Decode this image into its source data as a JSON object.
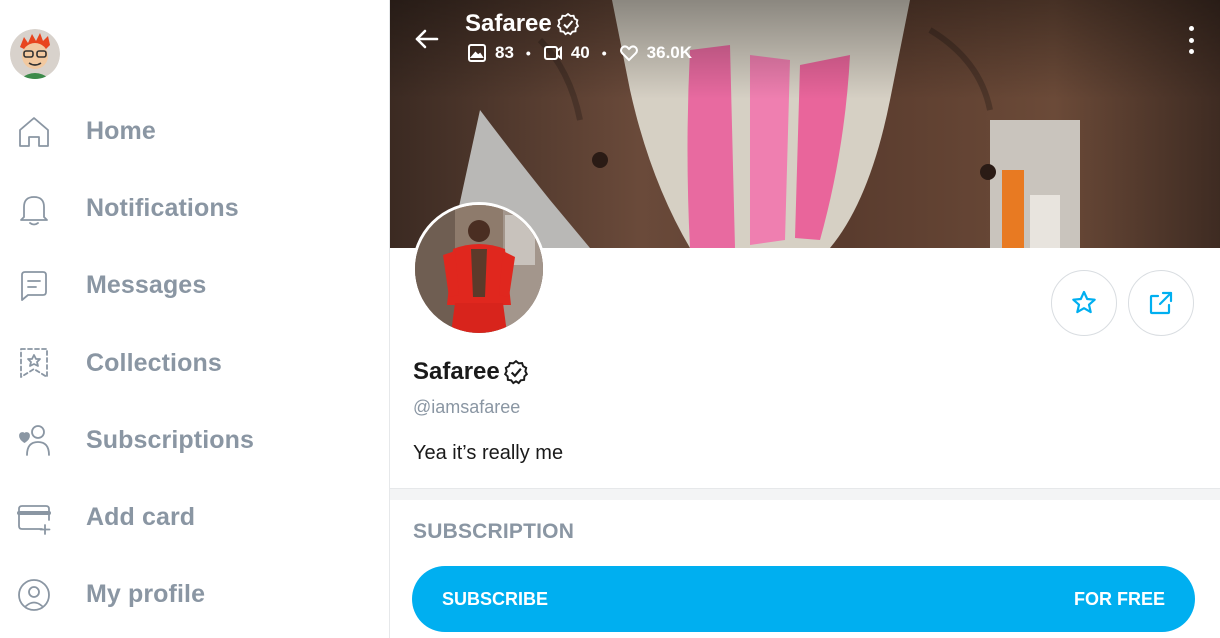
{
  "sidebar": {
    "items": [
      {
        "label": "Home",
        "icon": "home-icon"
      },
      {
        "label": "Notifications",
        "icon": "bell-icon"
      },
      {
        "label": "Messages",
        "icon": "message-icon"
      },
      {
        "label": "Collections",
        "icon": "bookmark-star-icon"
      },
      {
        "label": "Subscriptions",
        "icon": "user-heart-icon"
      },
      {
        "label": "Add card",
        "icon": "credit-card-plus-icon"
      },
      {
        "label": "My profile",
        "icon": "user-circle-icon"
      }
    ]
  },
  "header": {
    "name": "Safaree",
    "stats": {
      "photos": "83",
      "videos": "40",
      "likes": "36.0K"
    }
  },
  "profile": {
    "name": "Safaree",
    "handle": "@iamsafaree",
    "bio": "Yea it’s really me"
  },
  "subscription": {
    "title": "SUBSCRIPTION",
    "button_label": "SUBSCRIBE",
    "button_price": "FOR FREE"
  },
  "colors": {
    "accent": "#00aff0",
    "muted": "#8a96a3",
    "text": "#1a1a1a"
  }
}
